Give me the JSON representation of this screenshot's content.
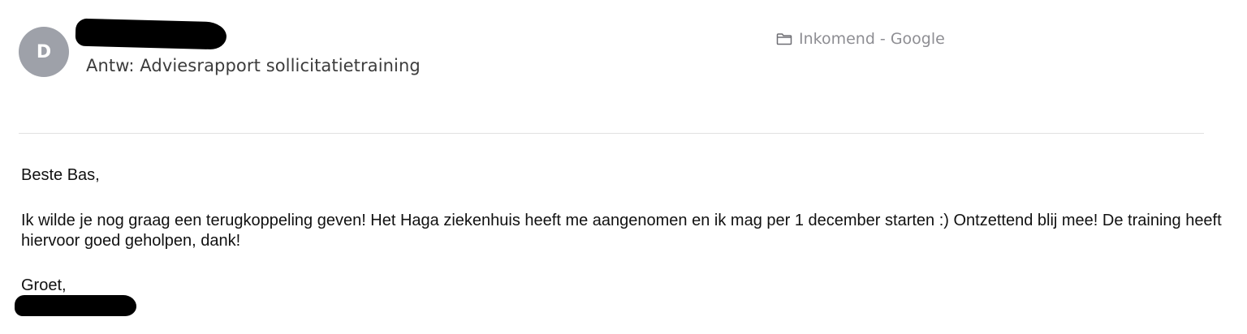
{
  "email": {
    "sender_initial": "D",
    "subject": "Antw: Adviesrapport sollicitatietraining",
    "folder_label": "Inkomend - Google",
    "folder_icon": "folder-icon",
    "body": {
      "greeting": "Beste Bas,",
      "message": "Ik wilde je nog graag een terugkoppeling geven! Het Haga ziekenhuis heeft me aangenomen en ik mag per 1 december starten :) Ontzettend blij mee! De training heeft hiervoor goed geholpen, dank!",
      "closing": "Groet,"
    }
  },
  "colors": {
    "avatar_bg": "#9ea1a9",
    "redaction": "#000000",
    "muted_text": "#8e8e93",
    "divider": "#e2e2e2"
  }
}
